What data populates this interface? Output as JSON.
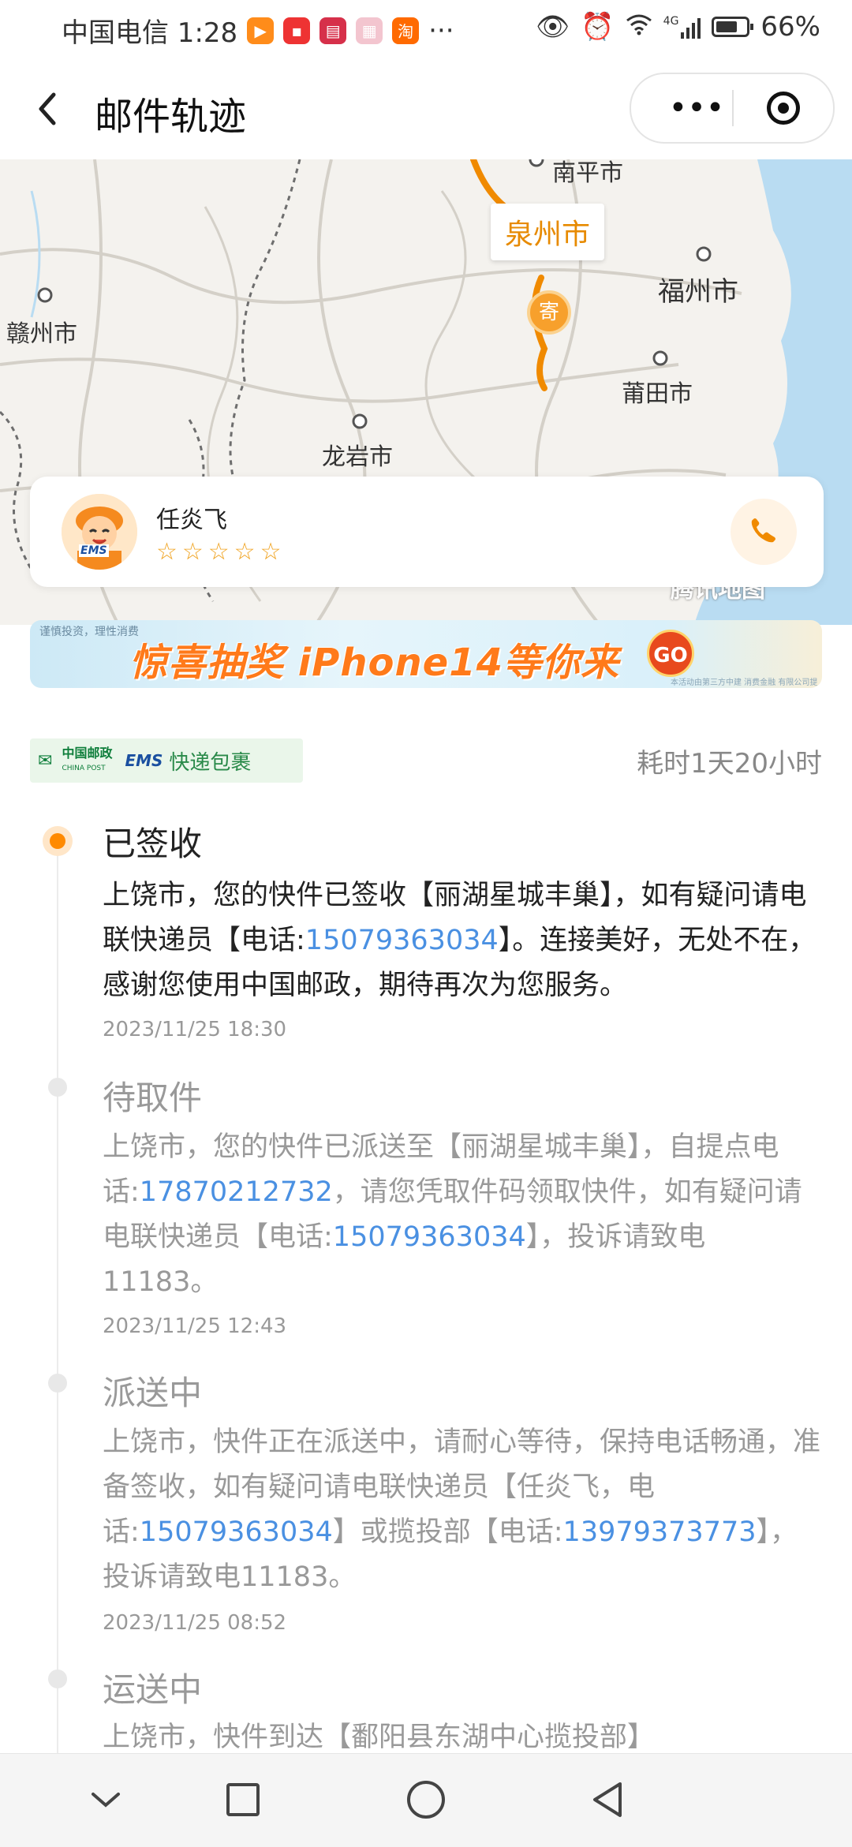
{
  "status_bar": {
    "carrier_time": "中国电信 1:28",
    "more": "···",
    "battery_percent": "66%",
    "network": "4G"
  },
  "nav": {
    "title": "邮件轨迹",
    "more_label": "•••"
  },
  "map": {
    "cities": [
      "南平市",
      "赣州市",
      "福州市",
      "莆田市",
      "龙岩市"
    ],
    "pin_city": "泉州市",
    "pin_char": "寄",
    "watermark": "腾讯地图"
  },
  "courier": {
    "name": "任炎飞",
    "stars": "☆☆☆☆☆",
    "avatar_badge": "EMS"
  },
  "banner": {
    "small_text": "谨慎投资，理性消费",
    "headline": "惊喜抽奖 iPhone14等你来",
    "go_label": "GO",
    "fine_print": "本活动由第三方中建 消费金融 有限公司提供"
  },
  "carrier": {
    "post_name": "中国邮政",
    "post_en": "CHINA POST",
    "ems": "EMS",
    "type": "快递包裹",
    "duration": "耗时1天20小时"
  },
  "timeline": [
    {
      "title": "已签收",
      "body_1": "上饶市，您的快件已签收【丽湖星城丰巢】，如有疑问请电联快递员【电话:",
      "phone_1": "15079363034",
      "body_2": "】。连接美好，无处不在，感谢您使用中国邮政，期待再次为您服务。",
      "time": "2023/11/25 18:30"
    },
    {
      "title": "待取件",
      "body_1": "上饶市，您的快件已派送至【丽湖星城丰巢】，自提点电话:",
      "phone_1": "17870212732",
      "body_2": "，请您凭取件码领取快件，如有疑问请电联快递员【电话:",
      "phone_2": "15079363034",
      "body_3": "】，投诉请致电11183。",
      "time": "2023/11/25 12:43"
    },
    {
      "title": "派送中",
      "body_1": "上饶市，快件正在派送中，请耐心等待，保持电话畅通，准备签收，如有疑问请电联快递员【任炎飞，电话:",
      "phone_1": "15079363034",
      "body_2": "】或揽投部【电话:",
      "phone_2": "13979373773",
      "body_3": "】，投诉请致电11183。",
      "time": "2023/11/25 08:52"
    },
    {
      "title": "运送中",
      "body_1": "上饶市，快件到达【鄱阳县东湖中心揽投部】"
    }
  ]
}
